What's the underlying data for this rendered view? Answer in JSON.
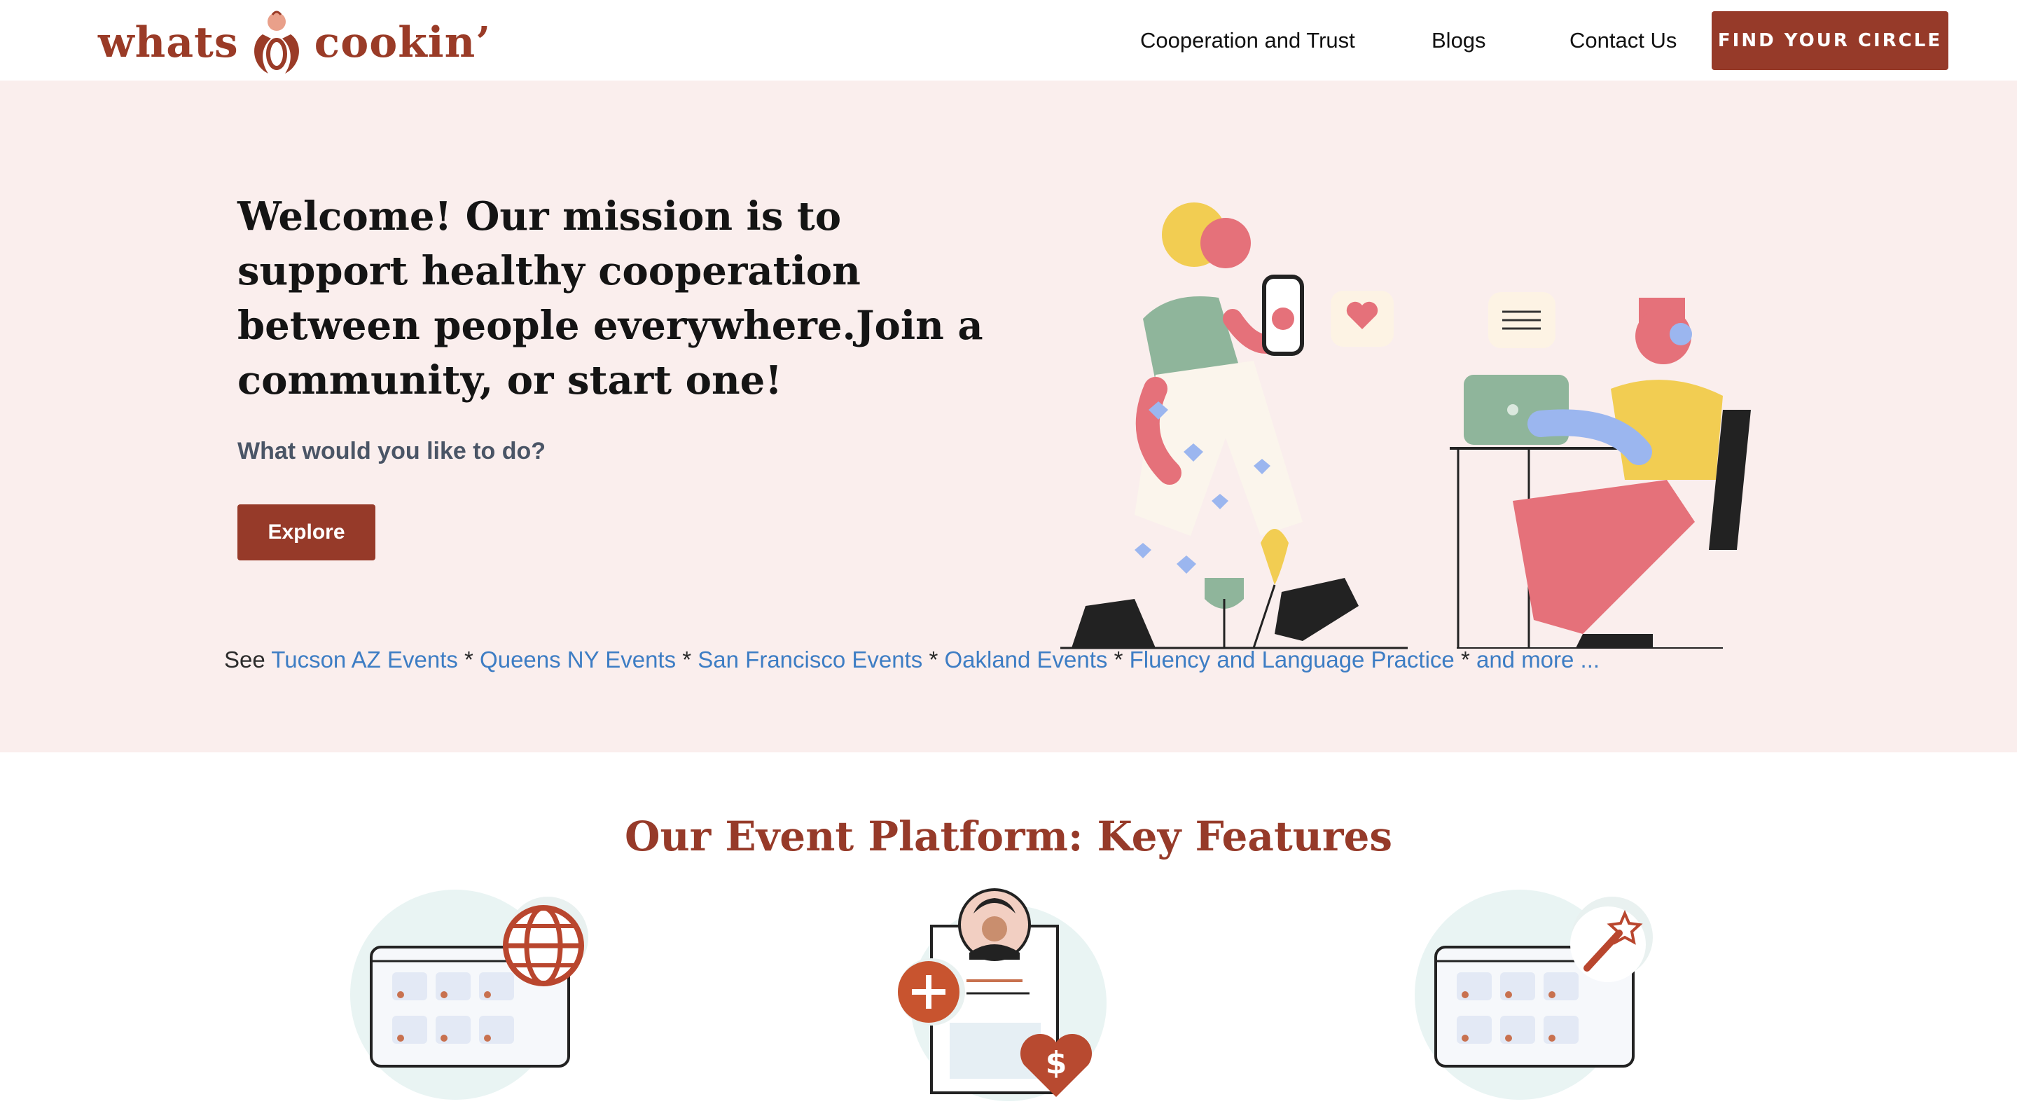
{
  "header": {
    "logo": {
      "word_left": "whats",
      "word_right": "cookin’"
    },
    "nav": [
      {
        "label": "Cooperation and Trust"
      },
      {
        "label": "Blogs"
      },
      {
        "label": "Contact Us"
      }
    ],
    "cta_label": "FIND YOUR CIRCLE"
  },
  "hero": {
    "title": "Welcome! Our mission is to support healthy cooperation between people everywhere.Join a community, or start one!",
    "subtitle": "What would you like to do?",
    "explore_label": "Explore",
    "events": {
      "prefix": "See",
      "separator": "*",
      "links": [
        "Tucson AZ Events",
        "Queens NY Events",
        "San Francisco Events",
        "Oakland Events",
        "Fluency and Language Practice",
        "and more ..."
      ]
    }
  },
  "features": {
    "title": "Our Event Platform: Key Features"
  },
  "colors": {
    "brand": "#963a29",
    "hero_bg": "#faeeed",
    "link": "#3d7dc4"
  },
  "icons": [
    "logo-mark-icon",
    "people-illustration-icon",
    "globe-calendar-icon",
    "profile-add-donate-icon",
    "magic-wand-calendar-icon"
  ]
}
